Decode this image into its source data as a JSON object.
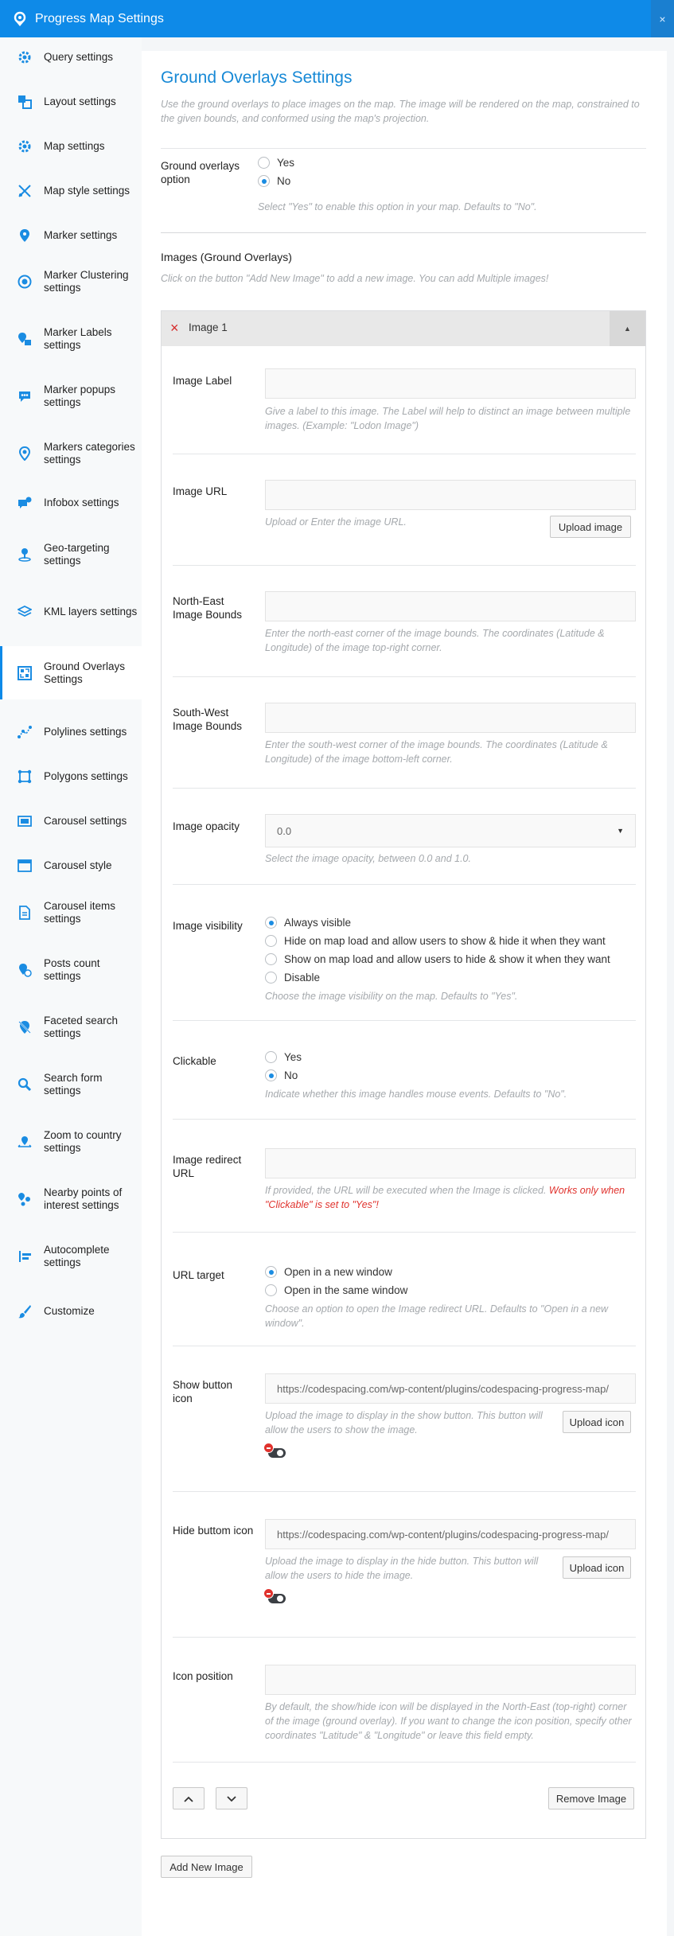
{
  "window": {
    "title": "Progress Map Settings",
    "close_label": "×"
  },
  "sidebar": {
    "items": [
      {
        "label": "Query settings",
        "icon": "gear-icon"
      },
      {
        "label": "Layout settings",
        "icon": "layout-icon"
      },
      {
        "label": "Map settings",
        "icon": "gear-icon"
      },
      {
        "label": "Map style settings",
        "icon": "map-style-icon"
      },
      {
        "label": "Marker settings",
        "icon": "marker-icon"
      },
      {
        "label": "Marker Clustering settings",
        "icon": "cluster-icon"
      },
      {
        "label": "Marker Labels settings",
        "icon": "marker-label-icon"
      },
      {
        "label": "Marker popups settings",
        "icon": "popup-icon"
      },
      {
        "label": "Markers categories settings",
        "icon": "categories-icon"
      },
      {
        "label": "Infobox settings",
        "icon": "infobox-icon"
      },
      {
        "label": "Geo-targeting settings",
        "icon": "geo-target-icon"
      },
      {
        "label": "KML layers settings",
        "icon": "layers-icon"
      },
      {
        "label": "Ground Overlays Settings",
        "icon": "ground-overlay-icon"
      },
      {
        "label": "Polylines settings",
        "icon": "polyline-icon"
      },
      {
        "label": "Polygons settings",
        "icon": "polygon-icon"
      },
      {
        "label": "Carousel settings",
        "icon": "carousel-icon"
      },
      {
        "label": "Carousel style",
        "icon": "carousel-style-icon"
      },
      {
        "label": "Carousel items settings",
        "icon": "carousel-items-icon"
      },
      {
        "label": "Posts count settings",
        "icon": "posts-count-icon"
      },
      {
        "label": "Faceted search settings",
        "icon": "faceted-search-icon"
      },
      {
        "label": "Search form settings",
        "icon": "search-icon"
      },
      {
        "label": "Zoom to country settings",
        "icon": "zoom-country-icon"
      },
      {
        "label": "Nearby points of interest settings",
        "icon": "nearby-icon"
      },
      {
        "label": "Autocomplete settings",
        "icon": "autocomplete-icon"
      },
      {
        "label": "Customize",
        "icon": "brush-icon"
      }
    ],
    "active_index": 12
  },
  "page": {
    "title": "Ground Overlays Settings",
    "description": "Use the ground overlays to place images on the map. The image will be rendered on the map, constrained to the given bounds, and conformed using the map's projection."
  },
  "option": {
    "label": "Ground overlays option",
    "choices": [
      "Yes",
      "No"
    ],
    "selected": "No",
    "help": "Select \"Yes\" to enable this option in your map. Defaults to \"No\"."
  },
  "images": {
    "heading": "Images (Ground Overlays)",
    "help": "Click on the button \"Add New Image\" to add a new image. You can add Multiple images!",
    "add_button": "Add New Image"
  },
  "image": {
    "title": "Image 1",
    "remove_icon": "×",
    "collapse_icon": "▲",
    "label": {
      "label": "Image Label",
      "value": "",
      "help": "Give a label to this image. The Label will help to distinct an image between multiple images. (Example: \"Lodon Image\")"
    },
    "url": {
      "label": "Image URL",
      "value": "",
      "help": "Upload or Enter the image URL.",
      "button": "Upload image"
    },
    "ne_bounds": {
      "label": "North-East Image Bounds",
      "value": "",
      "help": "Enter the north-east corner of the image bounds. The coordinates (Latitude & Longitude) of the image top-right corner."
    },
    "sw_bounds": {
      "label": "South-West Image Bounds",
      "value": "",
      "help": "Enter the south-west corner of the image bounds. The coordinates (Latitude & Longitude) of the image bottom-left corner."
    },
    "opacity": {
      "label": "Image opacity",
      "value": "0.0",
      "arrow": "▼",
      "help": "Select the image opacity, between 0.0 and 1.0."
    },
    "visibility": {
      "label": "Image visibility",
      "choices": [
        "Always visible",
        "Hide on map load and allow users to show & hide it when they want",
        "Show on map load and allow users to hide & show it when they want",
        "Disable"
      ],
      "selected": "Always visible",
      "help": "Choose the image visibility on the map. Defaults to \"Yes\"."
    },
    "clickable": {
      "label": "Clickable",
      "choices": [
        "Yes",
        "No"
      ],
      "selected": "No",
      "help": "Indicate whether this image handles mouse events. Defaults to \"No\"."
    },
    "redirect": {
      "label": "Image redirect URL",
      "value": "",
      "help": "If provided, the URL will be executed when the Image is clicked.",
      "warning": "Works only when \"Clickable\" is set to \"Yes\"!"
    },
    "target": {
      "label": "URL target",
      "choices": [
        "Open in a new window",
        "Open in the same window"
      ],
      "selected": "Open in a new window",
      "help": "Choose an option to open the Image redirect URL. Defaults to \"Open in a new window\"."
    },
    "show_icon": {
      "label": "Show button icon",
      "value": "https://codespacing.com/wp-content/plugins/codespacing-progress-map/",
      "help": "Upload the image to display in the show button. This button will allow the users to show the image.",
      "button": "Upload icon"
    },
    "hide_icon": {
      "label": "Hide buttom icon",
      "value": "https://codespacing.com/wp-content/plugins/codespacing-progress-map/",
      "help": "Upload the image to display in the hide button. This button will allow the users to hide the image.",
      "button": "Upload icon"
    },
    "icon_position": {
      "label": "Icon position",
      "value": "",
      "help": "By default, the show/hide icon will be displayed in the North-East (top-right) corner of the image (ground overlay). If you want to change the icon position, specify other coordinates \"Latitude\" & \"Longitude\" or leave this field empty."
    },
    "move_up_icon": "chevron-up",
    "move_down_icon": "chevron-down",
    "remove_button": "Remove Image"
  },
  "colors": {
    "accent": "#0e8ae8",
    "title": "#1789d6",
    "warning": "#e0322d"
  }
}
